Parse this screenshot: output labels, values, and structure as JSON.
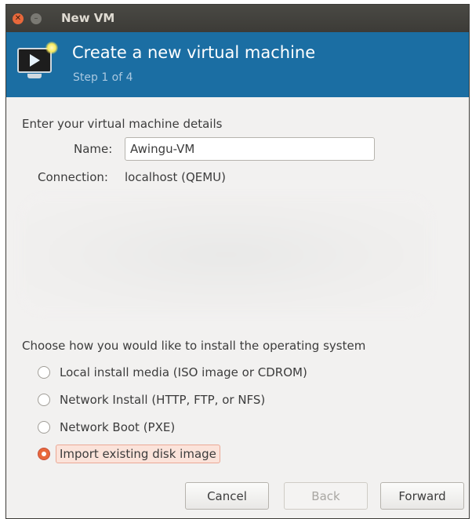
{
  "window": {
    "title": "New VM"
  },
  "banner": {
    "heading": "Create a new virtual machine",
    "step": "Step 1 of 4"
  },
  "details": {
    "section_label": "Enter your virtual machine details",
    "name_label": "Name:",
    "name_value": "Awingu-VM",
    "connection_label": "Connection:",
    "connection_value": "localhost (QEMU)"
  },
  "install": {
    "section_label": "Choose how you would like to install the operating system",
    "options": [
      {
        "label": "Local install media (ISO image or CDROM)",
        "selected": false
      },
      {
        "label": "Network Install (HTTP, FTP, or NFS)",
        "selected": false
      },
      {
        "label": "Network Boot (PXE)",
        "selected": false
      },
      {
        "label": "Import existing disk image",
        "selected": true
      }
    ]
  },
  "buttons": {
    "cancel": "Cancel",
    "back": "Back",
    "forward": "Forward"
  },
  "colors": {
    "accent": "#e8683b",
    "banner": "#1b6ea3",
    "titlebar": "#3c3b37"
  }
}
